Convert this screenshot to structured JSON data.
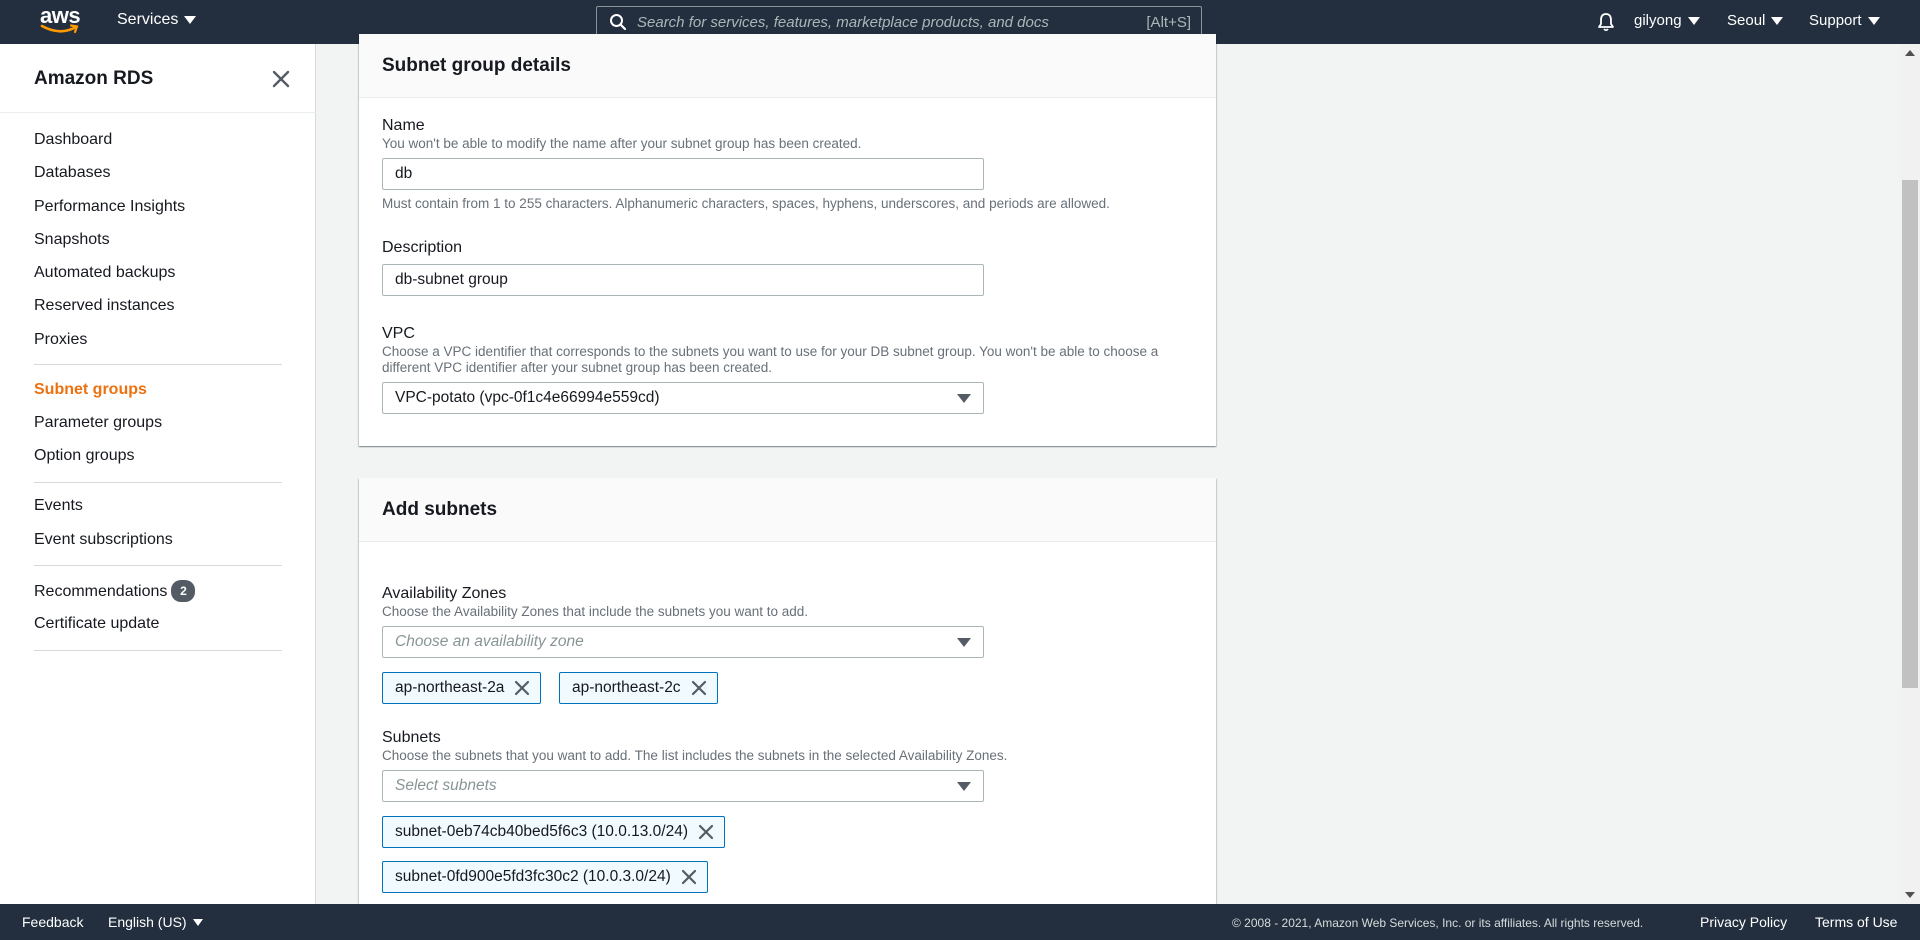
{
  "topnav": {
    "logo_text": "aws",
    "services_label": "Services",
    "search_placeholder": "Search for services, features, marketplace products, and docs",
    "search_shortcut": "[Alt+S]",
    "user_label": "gilyong",
    "region_label": "Seoul",
    "support_label": "Support"
  },
  "sidebar": {
    "title": "Amazon RDS",
    "group1": [
      "Dashboard",
      "Databases",
      "Performance Insights",
      "Snapshots",
      "Automated backups",
      "Reserved instances",
      "Proxies"
    ],
    "group2": [
      "Subnet groups",
      "Parameter groups",
      "Option groups"
    ],
    "group3": [
      "Events",
      "Event subscriptions"
    ],
    "recommendations_label": "Recommendations",
    "recommendations_count": "2",
    "certificate_label": "Certificate update"
  },
  "details": {
    "title": "Subnet group details",
    "name_label": "Name",
    "name_desc": "You won't be able to modify the name after your subnet group has been created.",
    "name_value": "db",
    "name_hint": "Must contain from 1 to 255 characters. Alphanumeric characters, spaces, hyphens, underscores, and periods are allowed.",
    "description_label": "Description",
    "description_value": "db-subnet group",
    "vpc_label": "VPC",
    "vpc_desc_line1": "Choose a VPC identifier that corresponds to the subnets you want to use for your DB subnet group. You won't be able to choose a",
    "vpc_desc_line2": "different VPC identifier after your subnet group has been created.",
    "vpc_value": "VPC-potato (vpc-0f1c4e66994e559cd)"
  },
  "subnets_panel": {
    "title": "Add subnets",
    "az_label": "Availability Zones",
    "az_desc": "Choose the Availability Zones that include the subnets you want to add.",
    "az_placeholder": "Choose an availability zone",
    "az_tokens": [
      "ap-northeast-2a",
      "ap-northeast-2c"
    ],
    "subnets_label": "Subnets",
    "subnets_desc": "Choose the subnets that you want to add. The list includes the subnets in the selected Availability Zones.",
    "subnets_placeholder": "Select subnets",
    "subnet_tokens": [
      "subnet-0eb74cb40bed5f6c3 (10.0.13.0/24)",
      "subnet-0fd900e5fd3fc30c2 (10.0.3.0/24)"
    ]
  },
  "footer": {
    "feedback": "Feedback",
    "language": "English (US)",
    "copyright": "© 2008 - 2021, Amazon Web Services, Inc. or its affiliates. All rights reserved.",
    "privacy": "Privacy Policy",
    "terms": "Terms of Use"
  },
  "colors": {
    "nav_bg": "#232f3e",
    "active": "#ec7211",
    "token_border": "#0073bb",
    "token_bg": "#f1faff"
  },
  "icons": [
    "search-icon",
    "bell-icon",
    "close-icon",
    "remove-icon",
    "caret-down-icon"
  ]
}
